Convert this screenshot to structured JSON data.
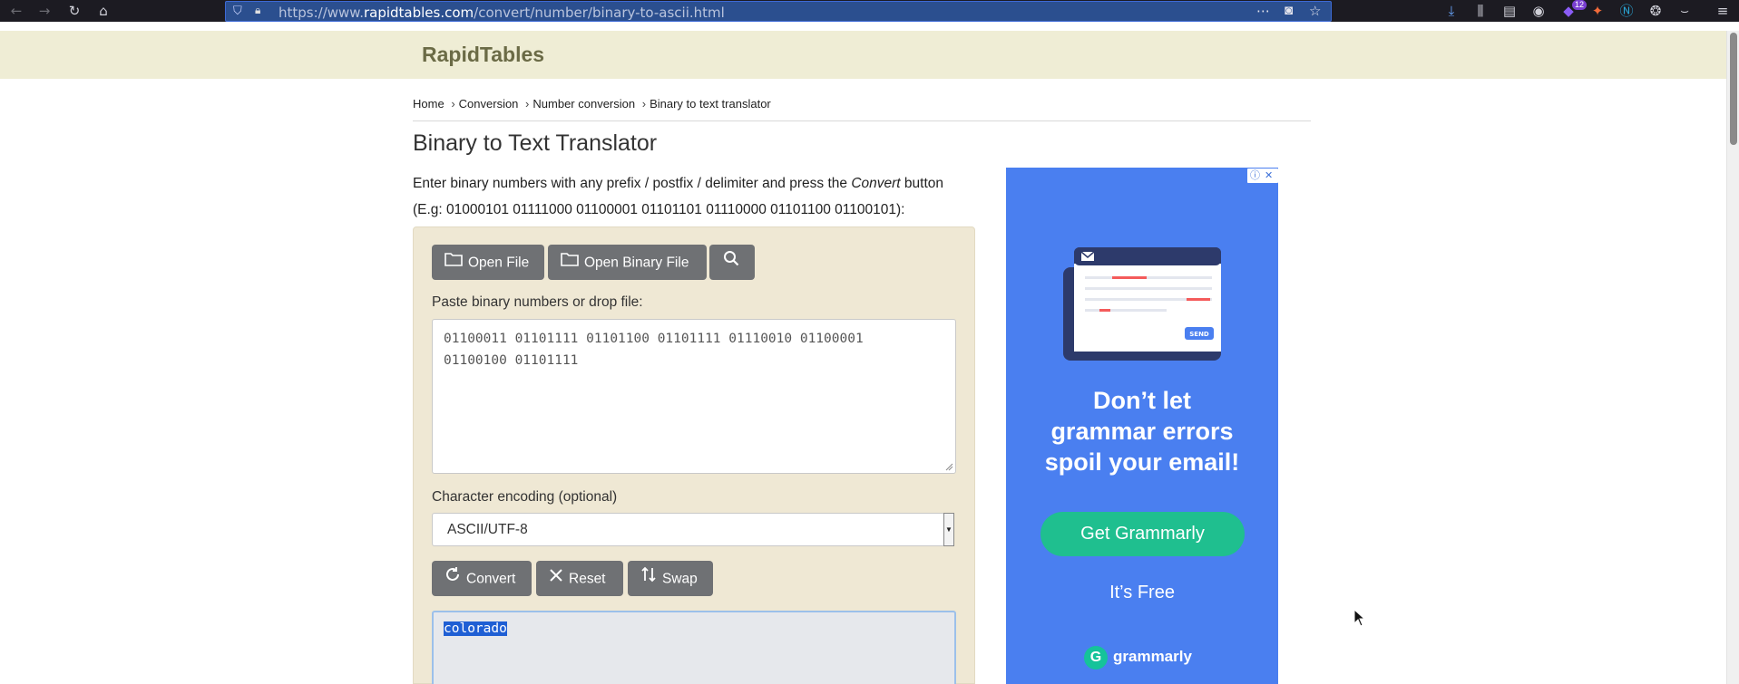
{
  "browser": {
    "url_prefix": "https://www.",
    "url_domain": "rapidtables.com",
    "url_path": "/convert/number/binary-to-ascii.html",
    "extension_badge": "12"
  },
  "site": {
    "logo": "RapidTables"
  },
  "breadcrumb": {
    "items": [
      "Home",
      "Conversion",
      "Number conversion",
      "Binary to text translator"
    ],
    "separator": "›"
  },
  "page": {
    "title": "Binary to Text Translator",
    "intro_text": "Enter binary numbers with any prefix / postfix / delimiter and press the ",
    "intro_emph": "Convert",
    "intro_tail": " button",
    "example": "(E.g: 01000101 01111000 01100001 01101101 01110000 01101100 01100101):"
  },
  "toolbar_buttons": {
    "open_file": "Open File",
    "open_binary_file": "Open Binary File"
  },
  "input": {
    "label": "Paste binary numbers or drop file:",
    "value_line1": "01100011 01101111 01101100 01101111 01110010 01100001",
    "value_line2": "01100100 01101111"
  },
  "encoding": {
    "label": "Character encoding (optional)",
    "selected": "ASCII/UTF-8"
  },
  "actions": {
    "convert": "Convert",
    "reset": "Reset",
    "swap": "Swap"
  },
  "output": {
    "value": "colorado"
  },
  "ad": {
    "headline_line1": "Don’t let",
    "headline_line2": "grammar errors",
    "headline_line3": "spoil your email!",
    "cta": "Get Grammarly",
    "sub": "It’s Free",
    "brand": "grammarly",
    "send_label": "SEND",
    "colors": {
      "background": "#4a7ff0",
      "cta": "#1fbf8f"
    }
  }
}
